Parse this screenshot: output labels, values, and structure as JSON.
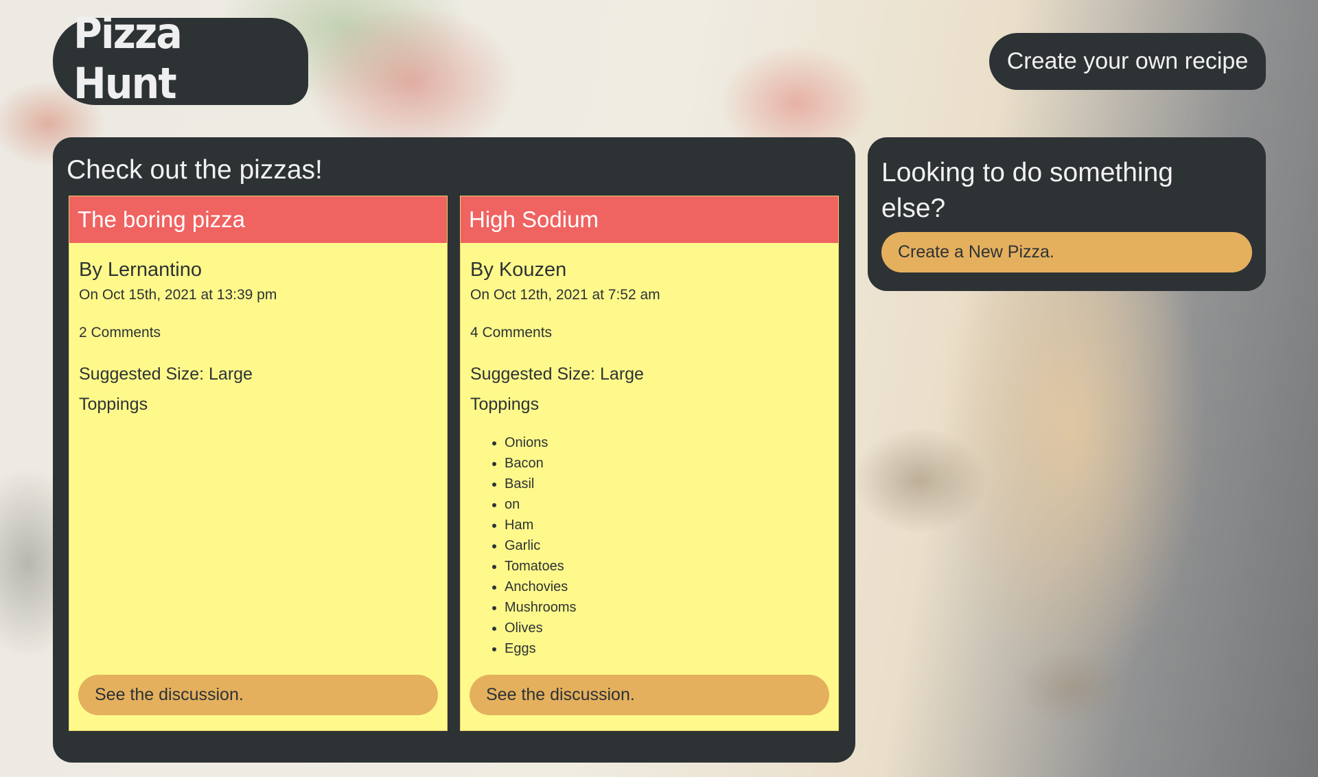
{
  "header": {
    "brand": "Pizza Hunt",
    "nav_recipe": "Create your own recipe"
  },
  "main": {
    "heading": "Check out the pizzas!",
    "pizzas": [
      {
        "name": "The boring pizza",
        "author": "By Lernantino",
        "date": "On Oct 15th, 2021 at 13:39 pm",
        "comments": "2 Comments",
        "size": "Suggested Size: Large",
        "toppings_label": "Toppings",
        "toppings": [],
        "discuss_label": "See the discussion."
      },
      {
        "name": "High Sodium",
        "author": "By Kouzen",
        "date": "On Oct 12th, 2021 at 7:52 am",
        "comments": "4 Comments",
        "size": "Suggested Size: Large",
        "toppings_label": "Toppings",
        "toppings": [
          "Onions",
          "Bacon",
          "Basil",
          "on",
          "Ham",
          "Garlic",
          "Tomatoes",
          "Anchovies",
          "Mushrooms",
          "Olives",
          "Eggs"
        ],
        "discuss_label": "See the discussion."
      }
    ]
  },
  "side": {
    "heading": "Looking to do something else?",
    "button": "Create a New Pizza."
  },
  "colors": {
    "panel": "#2d3235",
    "card_header": "#ef6361",
    "card_body": "#fff98b",
    "button": "#e4b05e"
  }
}
